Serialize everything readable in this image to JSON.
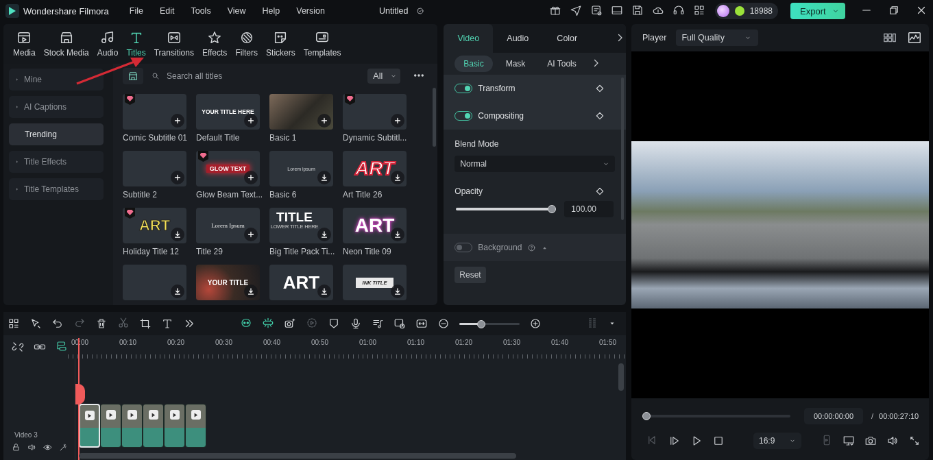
{
  "app": {
    "name": "Wondershare Filmora",
    "menu": [
      "File",
      "Edit",
      "Tools",
      "View",
      "Help",
      "Version"
    ],
    "document_title": "Untitled",
    "credits": "18988",
    "export_label": "Export"
  },
  "asset_tabs": [
    {
      "label": "Media",
      "selected": false
    },
    {
      "label": "Stock Media",
      "selected": false
    },
    {
      "label": "Audio",
      "selected": false
    },
    {
      "label": "Titles",
      "selected": true
    },
    {
      "label": "Transitions",
      "selected": false
    },
    {
      "label": "Effects",
      "selected": false
    },
    {
      "label": "Filters",
      "selected": false
    },
    {
      "label": "Stickers",
      "selected": false
    },
    {
      "label": "Templates",
      "selected": false
    }
  ],
  "categories": [
    {
      "label": "Mine",
      "expandable": true,
      "selected": false
    },
    {
      "label": "AI Captions",
      "expandable": true,
      "selected": false
    },
    {
      "label": "Trending",
      "expandable": false,
      "selected": true
    },
    {
      "label": "Title Effects",
      "expandable": true,
      "selected": false
    },
    {
      "label": "Title Templates",
      "expandable": true,
      "selected": false
    }
  ],
  "search": {
    "placeholder": "Search all titles"
  },
  "filter": "All",
  "titles": [
    {
      "label": "Comic Subtitle 01",
      "premium": true,
      "installed": true,
      "kind": "plain"
    },
    {
      "label": "Default Title",
      "premium": false,
      "installed": true,
      "kind": "banner",
      "preview": "YOUR TITLE HERE"
    },
    {
      "label": "Basic 1",
      "premium": false,
      "installed": true,
      "kind": "photo"
    },
    {
      "label": "Dynamic Subtitl...",
      "premium": true,
      "installed": true,
      "kind": "plain"
    },
    {
      "label": "Subtitle 2",
      "premium": false,
      "installed": true,
      "kind": "plain"
    },
    {
      "label": "Glow Beam Text...",
      "premium": true,
      "installed": true,
      "kind": "glow",
      "preview": "GLOW TEXT"
    },
    {
      "label": "Basic 6",
      "premium": false,
      "installed": false,
      "kind": "small",
      "preview": "Lorem ipsum"
    },
    {
      "label": "Art Title 26",
      "premium": false,
      "installed": false,
      "kind": "outline",
      "preview": "ART"
    },
    {
      "label": "Holiday Title 12",
      "premium": true,
      "installed": false,
      "kind": "yellow",
      "preview": "ART"
    },
    {
      "label": "Title 29",
      "premium": false,
      "installed": true,
      "kind": "serif",
      "preview": "Lorem Ipsum"
    },
    {
      "label": "Big Title Pack Ti...",
      "premium": false,
      "installed": false,
      "kind": "bold",
      "preview": "TITLE",
      "subpreview": "LOWER TITLE HERE"
    },
    {
      "label": "Neon Title 09",
      "premium": false,
      "installed": false,
      "kind": "neon",
      "preview": "ART"
    },
    {
      "premium": false,
      "installed": false,
      "kind": "plain"
    },
    {
      "premium": false,
      "installed": false,
      "kind": "flare",
      "preview": "YOUR TITLE"
    },
    {
      "premium": false,
      "installed": false,
      "kind": "heavy",
      "preview": "ART"
    },
    {
      "premium": false,
      "installed": false,
      "kind": "ink",
      "preview": "INK TITLE"
    }
  ],
  "properties": {
    "tabs": [
      {
        "label": "Video",
        "selected": true
      },
      {
        "label": "Audio",
        "selected": false
      },
      {
        "label": "Color",
        "selected": false
      }
    ],
    "subtabs": [
      {
        "label": "Basic",
        "selected": true
      },
      {
        "label": "Mask",
        "selected": false
      },
      {
        "label": "AI Tools",
        "selected": false
      }
    ],
    "sections": [
      {
        "label": "Transform",
        "on": true
      },
      {
        "label": "Compositing",
        "on": true
      }
    ],
    "blend_mode_label": "Blend Mode",
    "blend_mode": "Normal",
    "opacity_label": "Opacity",
    "opacity": {
      "level": 1.0,
      "value": "100.00"
    },
    "background": {
      "label": "Background",
      "on": false
    },
    "reset": "Reset"
  },
  "player": {
    "label": "Player",
    "quality": "Full Quality",
    "scrub": {
      "level": 0
    },
    "current_time": "00:00:00:00",
    "separator": "/",
    "total_time": "00:00:27:10",
    "aspect": "16:9"
  },
  "timeline": {
    "zoom": {
      "level": 0.36
    },
    "ruler": [
      "00:00",
      "00:10",
      "00:20",
      "00:30",
      "00:40",
      "00:50",
      "01:00",
      "01:10",
      "01:20",
      "01:30",
      "01:40",
      "01:50"
    ],
    "track": {
      "label": "Video 3"
    },
    "clips": [
      {
        "selected": true
      },
      {
        "selected": false
      },
      {
        "selected": false
      },
      {
        "selected": false
      },
      {
        "selected": false
      },
      {
        "selected": false
      }
    ]
  }
}
